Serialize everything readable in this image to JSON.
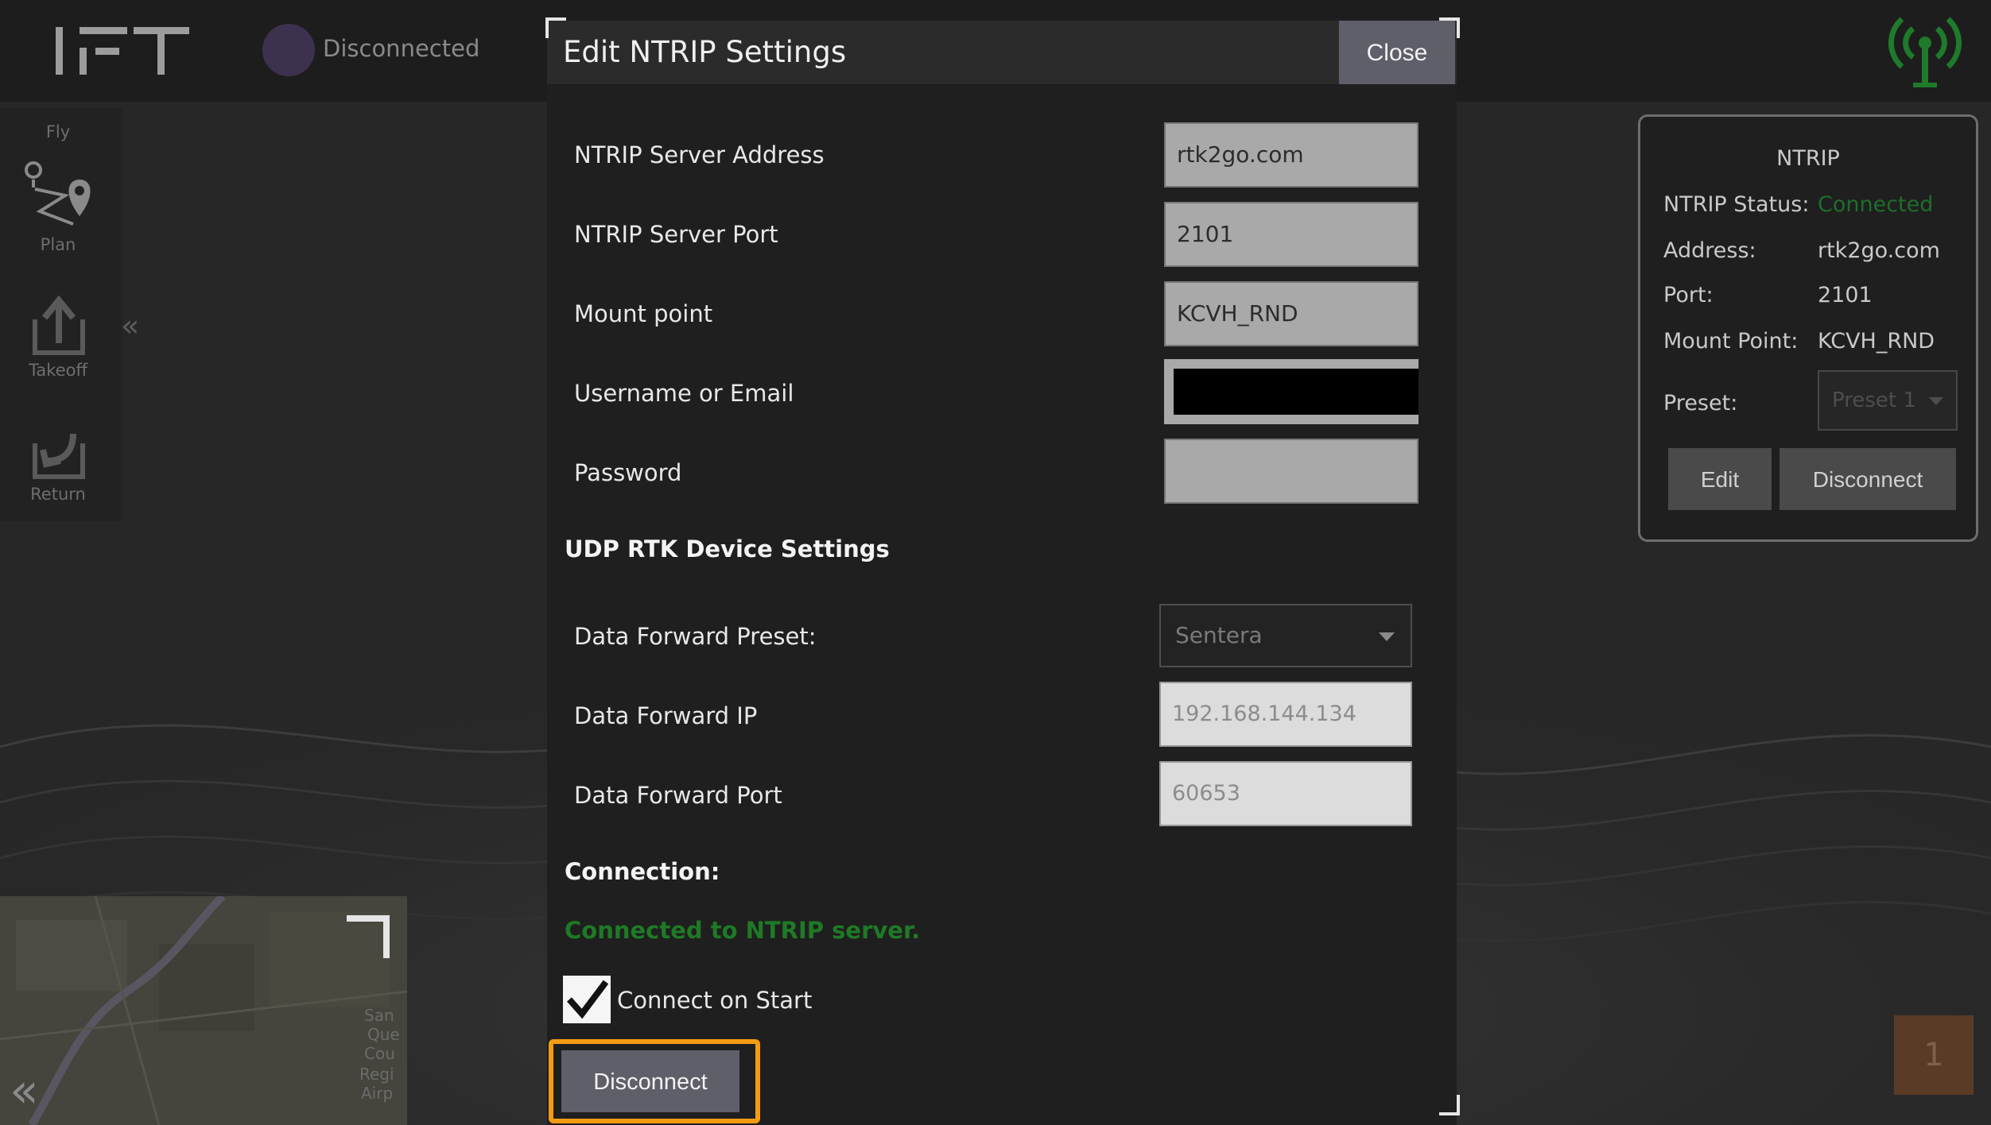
{
  "app": {
    "connection_status": "Disconnected"
  },
  "toolbar": {
    "items": [
      {
        "label": "Fly",
        "icon": "fly-icon"
      },
      {
        "label": "Plan",
        "icon": "plan-icon"
      },
      {
        "label": "Takeoff",
        "icon": "takeoff-icon"
      },
      {
        "label": "Return",
        "icon": "return-icon"
      }
    ]
  },
  "map": {
    "labels": [
      "San",
      "Que",
      "Cou",
      "Regi",
      "Airp"
    ]
  },
  "side_panel": {
    "title": "NTRIP",
    "status_label": "NTRIP Status:",
    "status_value": "Connected",
    "address_label": "Address:",
    "address_value": "rtk2go.com",
    "port_label": "Port:",
    "port_value": "2101",
    "mount_label": "Mount Point:",
    "mount_value": "KCVH_RND",
    "preset_label": "Preset:",
    "preset_value": "Preset 1",
    "edit_label": "Edit",
    "disconnect_label": "Disconnect"
  },
  "notification": {
    "count": "1"
  },
  "dialog": {
    "title": "Edit NTRIP Settings",
    "close_label": "Close",
    "fields": {
      "server_address": {
        "label": "NTRIP Server Address",
        "value": "rtk2go.com"
      },
      "server_port": {
        "label": "NTRIP Server Port",
        "value": "2101"
      },
      "mount_point": {
        "label": "Mount point",
        "value": "KCVH_RND"
      },
      "username": {
        "label": "Username or Email",
        "value": ""
      },
      "password": {
        "label": "Password",
        "value": ""
      }
    },
    "udp_section_title": "UDP RTK Device Settings",
    "udp": {
      "preset": {
        "label": "Data Forward Preset:",
        "value": "Sentera"
      },
      "ip": {
        "label": "Data Forward IP",
        "value": "192.168.144.134"
      },
      "port": {
        "label": "Data Forward Port",
        "value": "60653"
      }
    },
    "connection_section_title": "Connection:",
    "connection_status": "Connected to NTRIP server.",
    "connect_on_start_label": "Connect on Start",
    "connect_on_start_checked": true,
    "disconnect_label": "Disconnect"
  },
  "colors": {
    "accent_highlight": "#f39c12",
    "status_green": "#1e7a25",
    "button": "#5f5f6a"
  }
}
